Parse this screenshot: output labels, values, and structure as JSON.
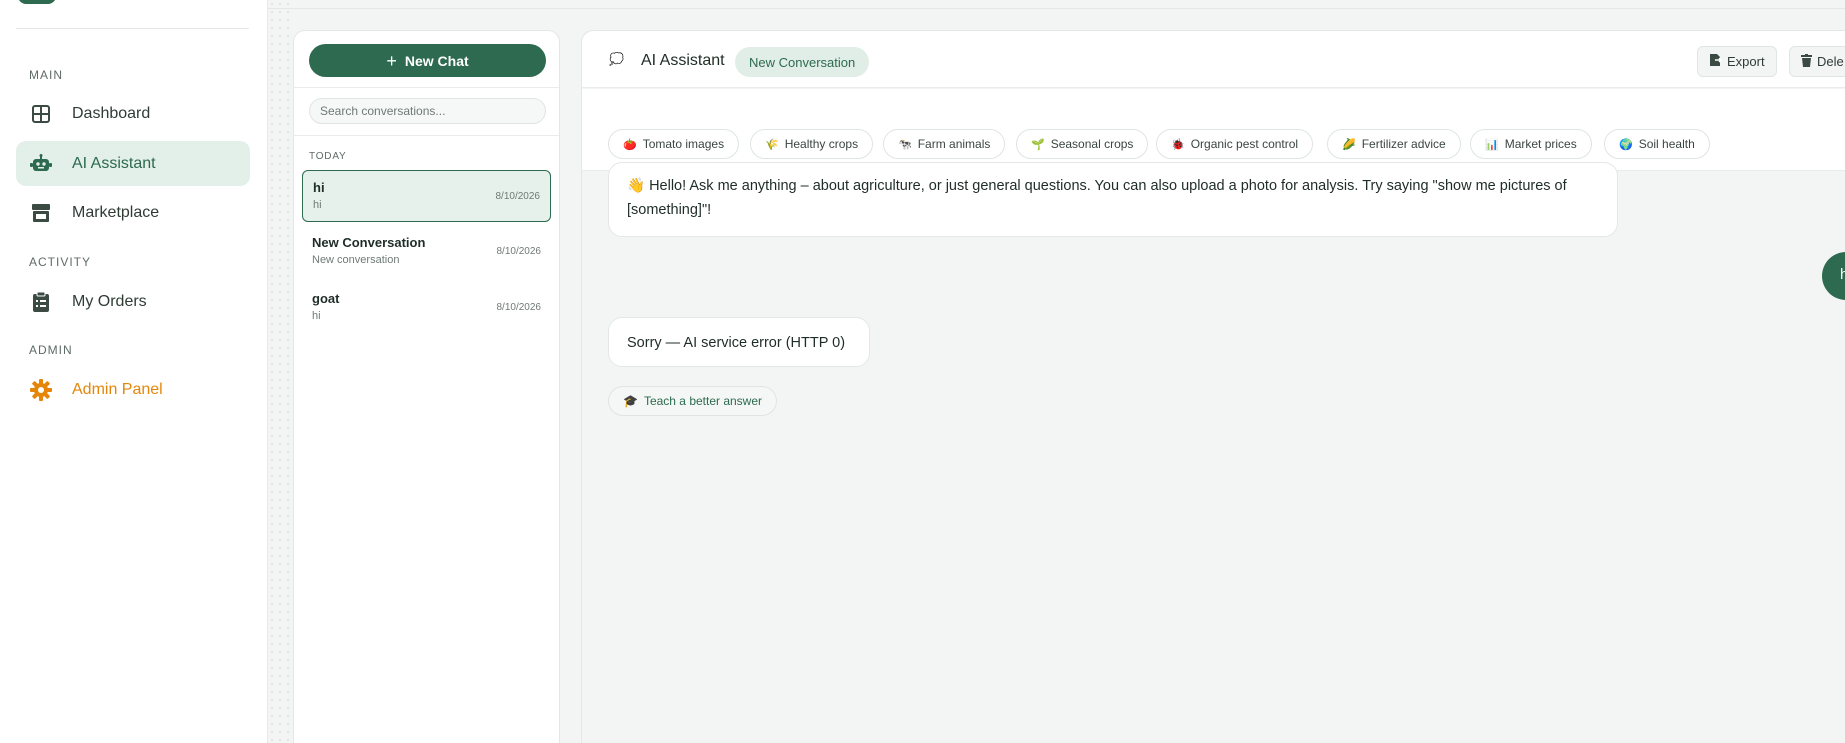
{
  "sidebar": {
    "sections": {
      "main": "MAIN",
      "activity": "ACTIVITY",
      "admin": "ADMIN"
    },
    "items": [
      {
        "label": "Dashboard",
        "icon": "grid-icon"
      },
      {
        "label": "AI Assistant",
        "icon": "robot-icon",
        "active": true
      },
      {
        "label": "Marketplace",
        "icon": "store-icon"
      },
      {
        "label": "My Orders",
        "icon": "clipboard-icon"
      },
      {
        "label": "Admin Panel",
        "icon": "gear-icon"
      }
    ]
  },
  "conversations": {
    "new_chat_label": "New Chat",
    "search_placeholder": "Search conversations...",
    "group_label": "TODAY",
    "items": [
      {
        "title": "hi",
        "preview": "hi",
        "date": "8/10/2026",
        "active": true
      },
      {
        "title": "New Conversation",
        "preview": "New conversation",
        "date": "8/10/2026"
      },
      {
        "title": "goat",
        "preview": "hi",
        "date": "8/10/2026"
      }
    ]
  },
  "chat": {
    "icon": "💭",
    "title": "AI Assistant",
    "badge": "New Conversation",
    "export_label": "Export",
    "delete_label": "Dele",
    "chips": [
      {
        "icon": "🍅",
        "label": "Tomato images"
      },
      {
        "icon": "🌾",
        "label": "Healthy crops"
      },
      {
        "icon": "🐄",
        "label": "Farm animals"
      },
      {
        "icon": "🌱",
        "label": "Seasonal crops"
      },
      {
        "icon": "🐞",
        "label": "Organic pest control"
      },
      {
        "icon": "🌽",
        "label": "Fertilizer advice"
      },
      {
        "icon": "📊",
        "label": "Market prices"
      },
      {
        "icon": "🌍",
        "label": "Soil health"
      }
    ],
    "messages": {
      "welcome": "👋 Hello! Ask me anything – about agriculture, or just general questions. You can also upload a photo for analysis. Try saying \"show me pictures of [something]\"!",
      "user": "hi",
      "error": "Sorry — AI service error (HTTP 0)"
    },
    "teach_label": "Teach a better answer",
    "teach_icon": "🎓"
  },
  "colors": {
    "brand": "#2d6a4f",
    "active_bg": "#e3efe9",
    "admin": "#e5860a"
  }
}
